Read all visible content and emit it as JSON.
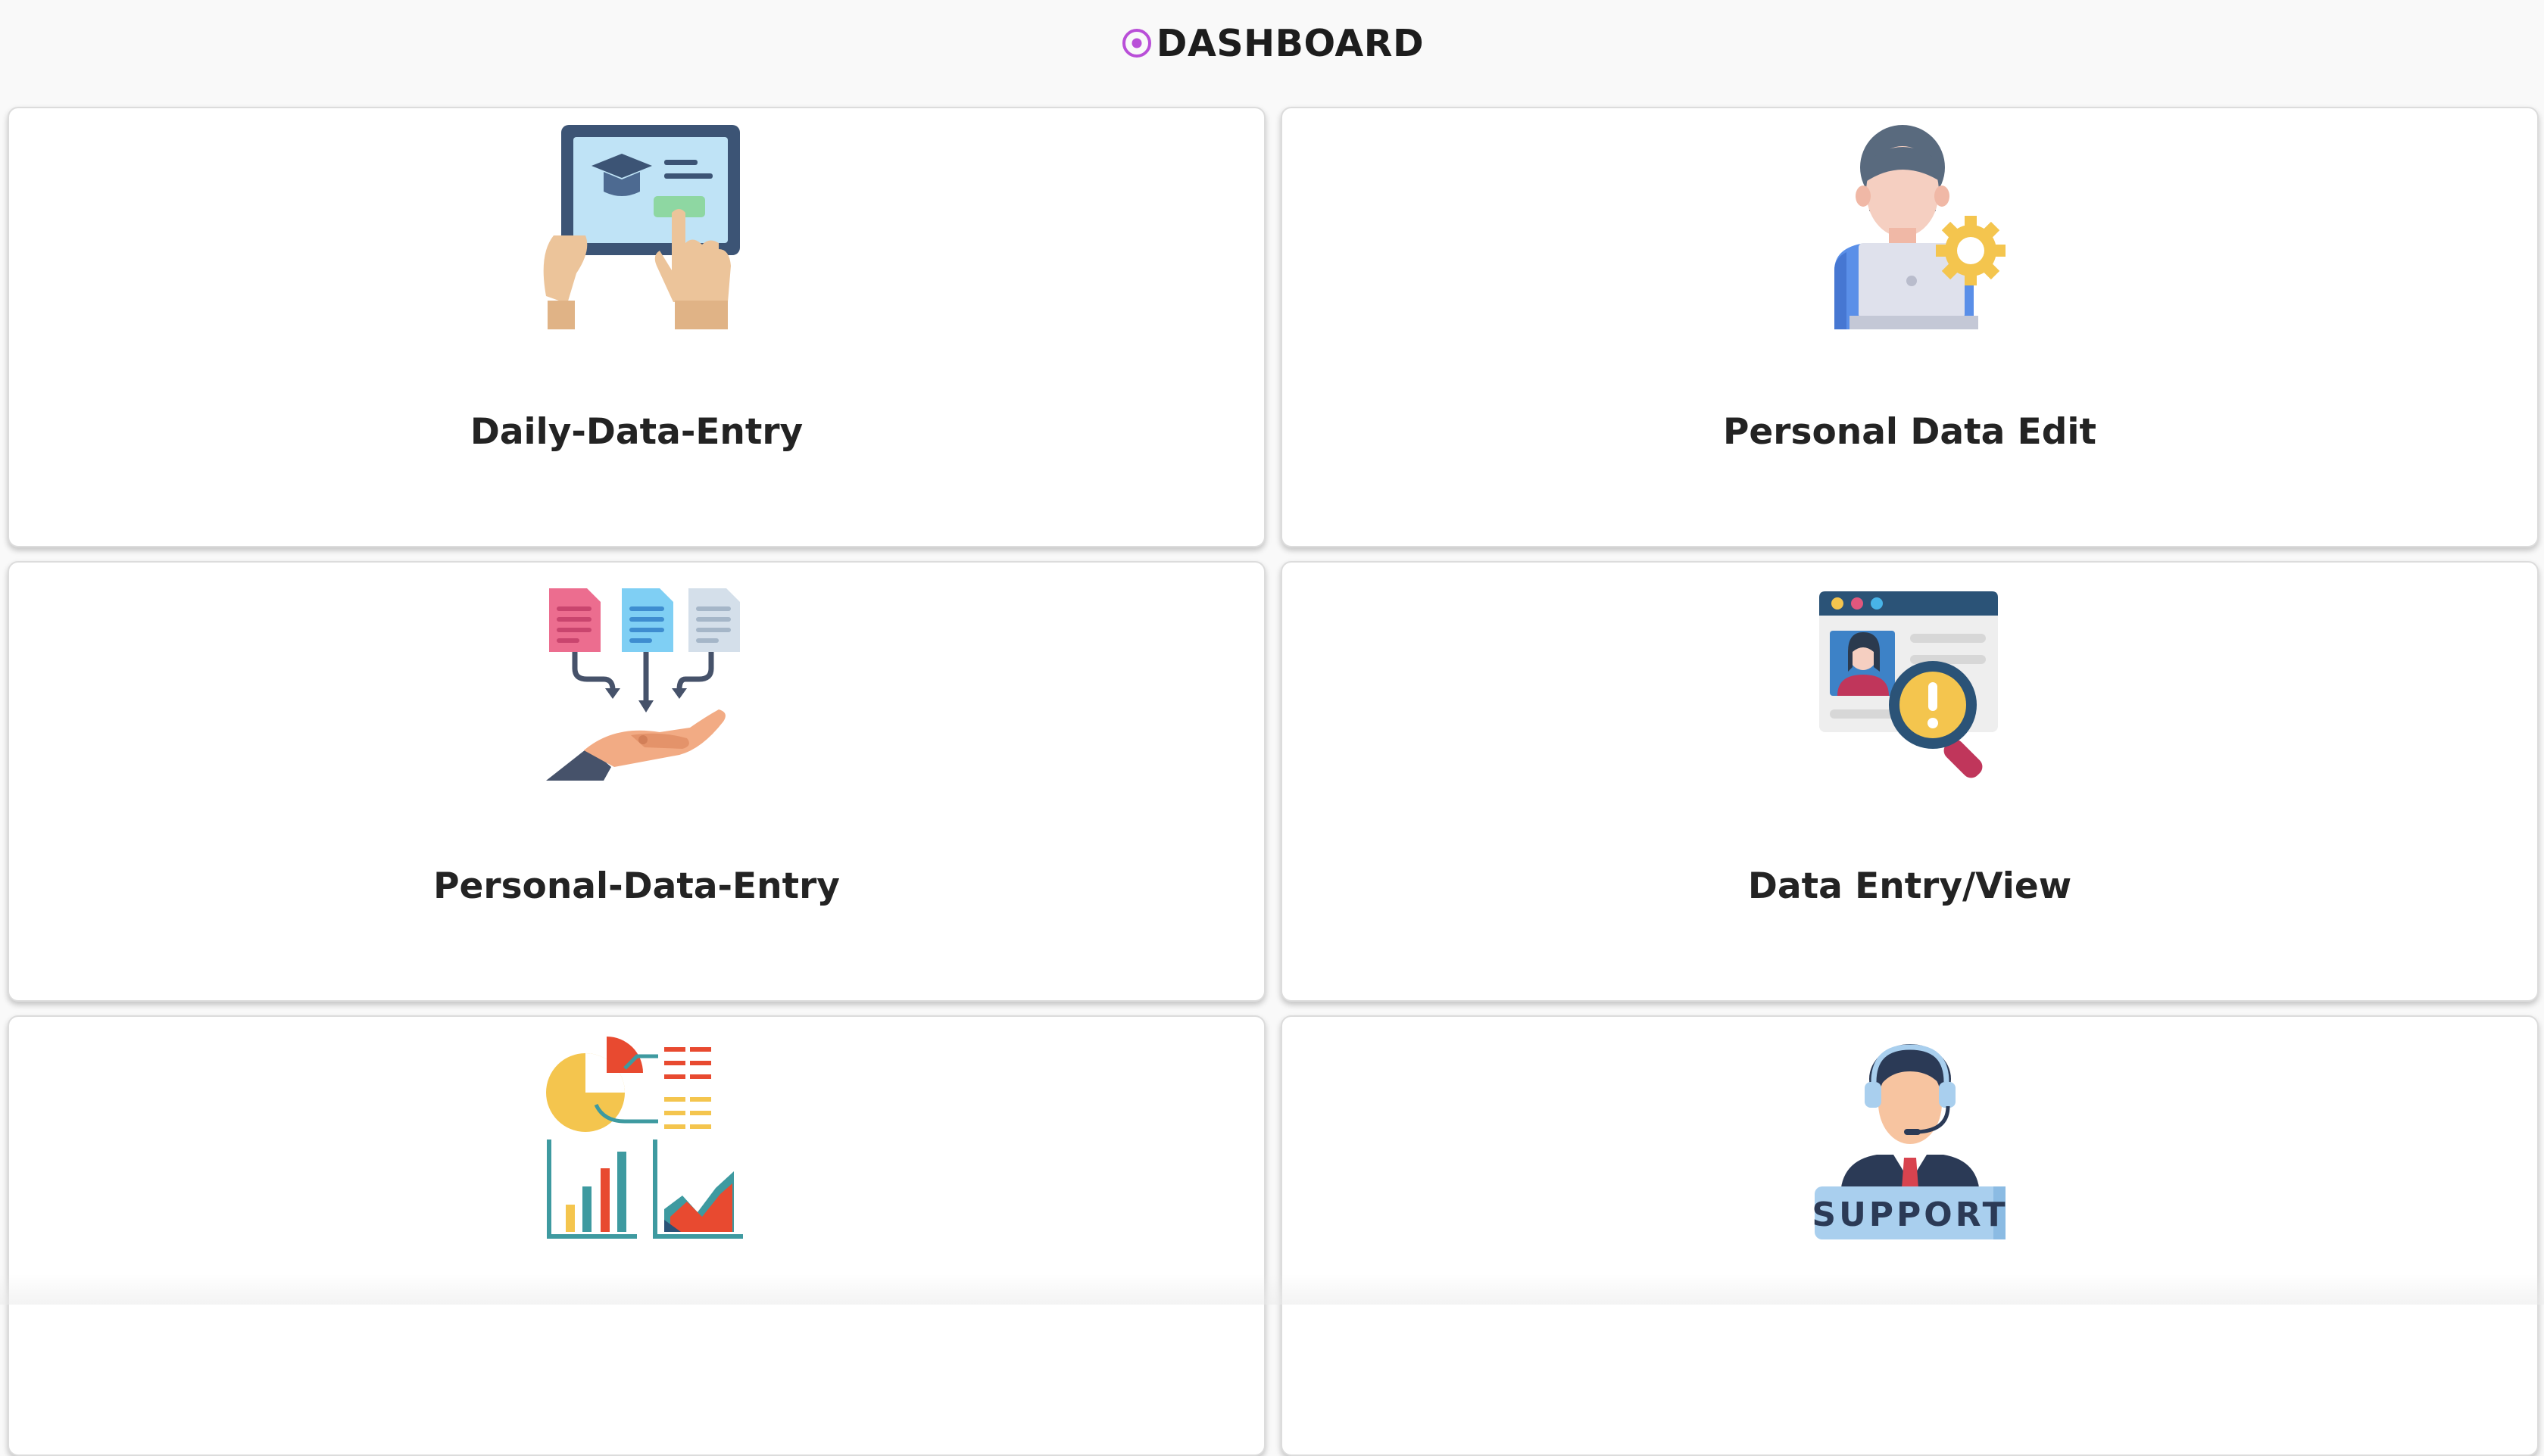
{
  "header": {
    "title": "DASHBOARD",
    "icon": "radio-dot-icon",
    "icon_color": "#b94fd8"
  },
  "cards": [
    {
      "label": "Daily-Data-Entry",
      "icon": "tablet-graduation-icon"
    },
    {
      "label": "Personal Data Edit",
      "icon": "user-laptop-gear-icon"
    },
    {
      "label": "Personal-Data-Entry",
      "icon": "documents-to-hand-icon"
    },
    {
      "label": "Data Entry/View",
      "icon": "profile-search-icon"
    },
    {
      "label": "",
      "icon": "charts-analytics-icon"
    },
    {
      "label": "",
      "icon": "support-agent-icon",
      "badge_text": "SUPPORT"
    }
  ]
}
